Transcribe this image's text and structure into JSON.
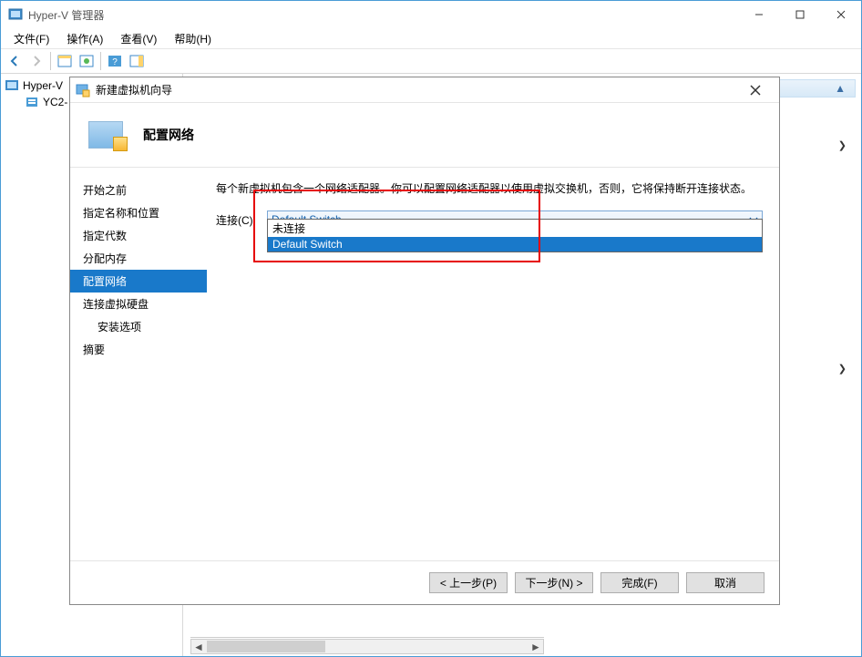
{
  "window": {
    "title": "Hyper-V 管理器"
  },
  "menu": {
    "file": "文件(F)",
    "action": "操作(A)",
    "view": "查看(V)",
    "help": "帮助(H)"
  },
  "tree": {
    "root": "Hyper-V",
    "node": "YC2-"
  },
  "right": {
    "caret": "▲",
    "chev1": "❯",
    "chev2": "❯"
  },
  "wizard": {
    "title": "新建虚拟机向导",
    "header": "配置网络",
    "nav": {
      "before": "开始之前",
      "name": "指定名称和位置",
      "gen": "指定代数",
      "mem": "分配内存",
      "net": "配置网络",
      "disk": "连接虚拟硬盘",
      "install": "安装选项",
      "summary": "摘要"
    },
    "content": {
      "desc": "每个新虚拟机包含一个网络适配器。你可以配置网络适配器以使用虚拟交换机，否则，它将保持断开连接状态。",
      "label": "连接(C):",
      "selected": "Default Switch",
      "options": {
        "none": "未连接",
        "default": "Default Switch"
      }
    },
    "buttons": {
      "prev": "< 上一步(P)",
      "next": "下一步(N) >",
      "finish": "完成(F)",
      "cancel": "取消"
    }
  }
}
